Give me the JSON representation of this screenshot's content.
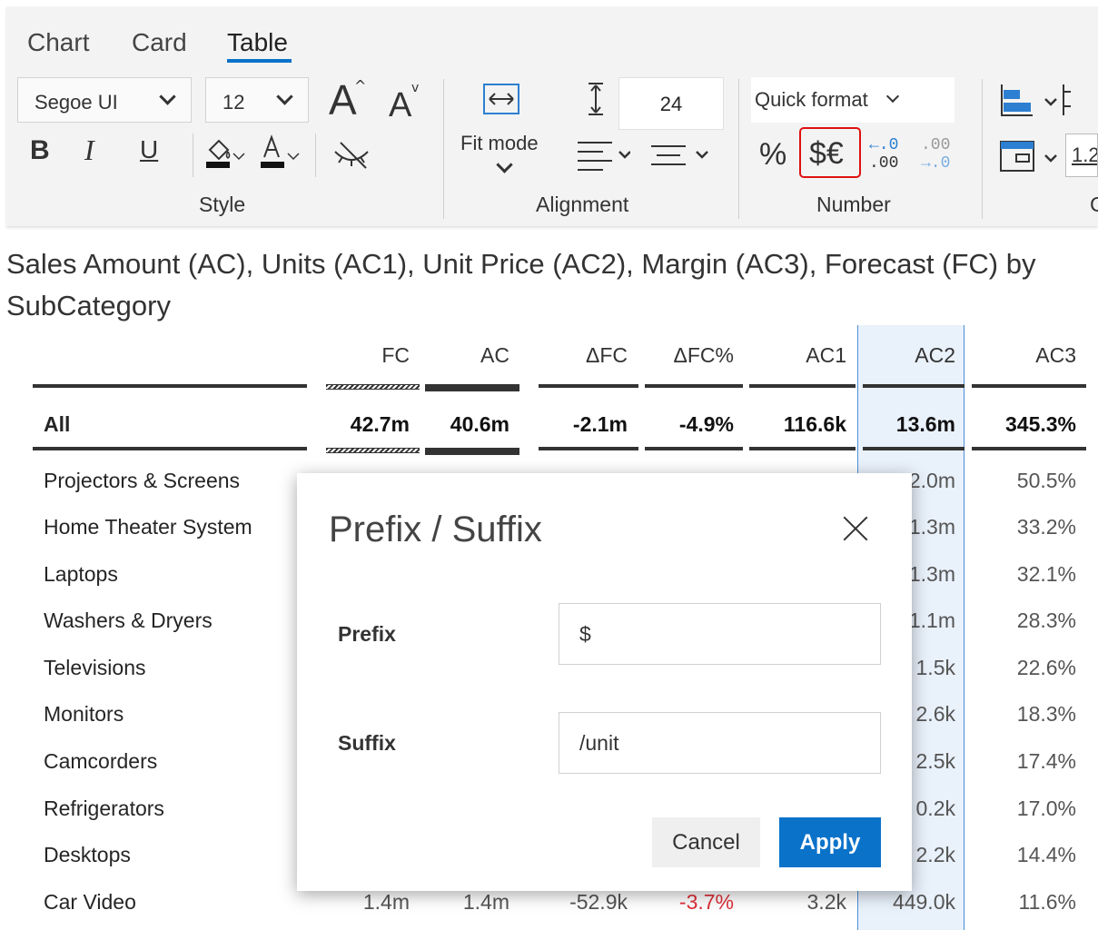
{
  "tabs": [
    "Chart",
    "Card",
    "Table"
  ],
  "style": {
    "font_family": "Segoe UI",
    "font_size": "12",
    "bold": "B",
    "italic": "I",
    "underline": "U",
    "grow_font": "A",
    "shrink_font": "A",
    "label": "Style"
  },
  "alignment": {
    "fit_mode": "Fit mode",
    "row_height": "24",
    "label": "Alignment"
  },
  "number": {
    "quick_format": "Quick format",
    "percent": "%",
    "prefix_suffix": "$€",
    "dec_increase_top": "←.0",
    "dec_increase_bottom": ".00",
    "dec_decrease_top": ".00",
    "dec_decrease_bottom": "→.0",
    "label": "Number"
  },
  "partial_value": "1.2",
  "partial_label": "C",
  "title": "Sales Amount (AC), Units (AC1), Unit Price (AC2), Margin (AC3), Forecast (FC) by SubCategory",
  "table": {
    "columns": [
      "FC",
      "AC",
      "ΔFC",
      "ΔFC%",
      "AC1",
      "AC2",
      "AC3"
    ],
    "total": {
      "label": "All",
      "values": [
        "42.7m",
        "40.6m",
        "-2.1m",
        "-4.9%",
        "116.6k",
        "13.6m",
        "345.3%"
      ]
    },
    "rows": [
      {
        "label": "Projectors & Screens",
        "ac2": "2.0m",
        "ac3": "50.5%"
      },
      {
        "label": "Home Theater System",
        "ac2": "1.3m",
        "ac3": "33.2%"
      },
      {
        "label": "Laptops",
        "ac2": "1.3m",
        "ac3": "32.1%"
      },
      {
        "label": "Washers & Dryers",
        "ac2": "1.1m",
        "ac3": "28.3%"
      },
      {
        "label": "Televisions",
        "ac2": "1.5k",
        "ac3": "22.6%"
      },
      {
        "label": "Monitors",
        "ac2": "2.6k",
        "ac3": "18.3%"
      },
      {
        "label": "Camcorders",
        "ac2": "2.5k",
        "ac3": "17.4%"
      },
      {
        "label": "Refrigerators",
        "ac2": "0.2k",
        "ac3": "17.0%"
      },
      {
        "label": "Desktops",
        "ac2": "2.2k",
        "ac3": "14.4%"
      },
      {
        "label": "Car Video",
        "fc": "1.4m",
        "ac": "1.4m",
        "dfc": "-52.9k",
        "dfcp": "-3.7%",
        "ac1": "3.2k",
        "ac2": "449.0k",
        "ac3": "11.6%"
      }
    ],
    "negative_color": "#e0303a"
  },
  "dialog": {
    "title": "Prefix / Suffix",
    "prefix_label": "Prefix",
    "prefix_value": "$",
    "suffix_label": "Suffix",
    "suffix_value": "/unit",
    "cancel": "Cancel",
    "apply": "Apply"
  },
  "colors": {
    "accent": "#0a72c9",
    "highlight": "#e01010",
    "column_highlight": "#e9f1fb"
  }
}
